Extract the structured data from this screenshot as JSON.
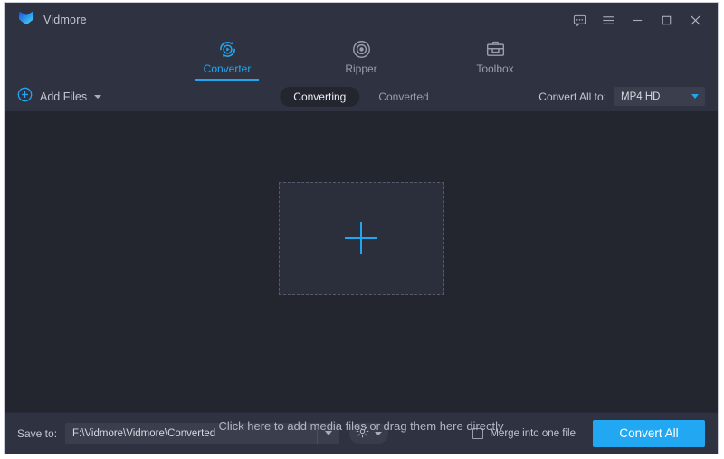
{
  "window": {
    "brand": "Vidmore",
    "logo_icon": "vidmore-logo-icon",
    "controls": {
      "feedback": "feedback-icon",
      "menu": "hamburger-menu-icon",
      "minimize": "minimize-icon",
      "maximize": "maximize-icon",
      "close": "close-icon"
    }
  },
  "tabs": [
    {
      "label": "Converter",
      "icon": "converter-icon",
      "active": true
    },
    {
      "label": "Ripper",
      "icon": "ripper-disc-icon",
      "active": false
    },
    {
      "label": "Toolbox",
      "icon": "toolbox-icon",
      "active": false
    }
  ],
  "toolbar": {
    "add_files_label": "Add Files",
    "add_files_icon": "plus-circle-icon",
    "add_files_caret": "chevron-down-icon",
    "segments": [
      {
        "label": "Converting",
        "active": true
      },
      {
        "label": "Converted",
        "active": false
      }
    ],
    "convert_all_to_label": "Convert All to:",
    "format_value": "MP4 HD",
    "format_caret": "chevron-down-icon"
  },
  "main": {
    "dropzone_icon": "plus-icon",
    "hint": "Click here to add media files or drag them here directly"
  },
  "bottom": {
    "save_to_label": "Save to:",
    "save_to_path": "F:\\Vidmore\\Vidmore\\Converted",
    "path_caret": "chevron-down-icon",
    "settings_icon": "gear-icon",
    "settings_caret": "chevron-down-icon",
    "merge_label": "Merge into one file",
    "merge_checked": false,
    "convert_all_label": "Convert All"
  },
  "colors": {
    "accent": "#22a7f2",
    "header_bg": "#2f3241",
    "content_bg": "#23262f",
    "panel_bg": "#2b2e3b",
    "text_primary": "#c3c6d0",
    "text_muted": "#9a9dab"
  }
}
